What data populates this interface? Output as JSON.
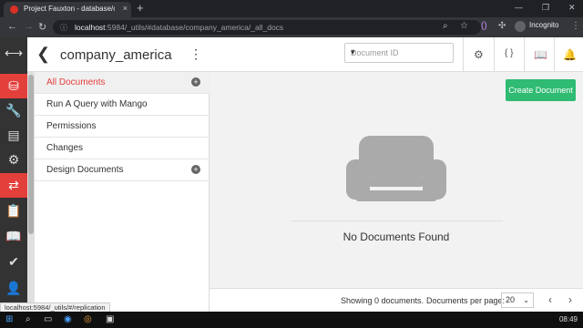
{
  "browser": {
    "tab_title": "Project Fauxton - database/comp",
    "url_host": "localhost",
    "url_rest": ":5984/_utils/#database/company_america/_all_docs",
    "incognito_label": "Incognito",
    "new_tab": "+",
    "tab_close": "×"
  },
  "header": {
    "db_name": "company_america",
    "doc_id_placeholder": "Document ID"
  },
  "sidenav": {
    "items": [
      {
        "label": "All Documents"
      },
      {
        "label": "Run A Query with Mango"
      },
      {
        "label": "Permissions"
      },
      {
        "label": "Changes"
      },
      {
        "label": "Design Documents"
      }
    ]
  },
  "main": {
    "create_label": "Create Document",
    "empty_label": "No Documents Found"
  },
  "footer": {
    "showing": "Showing 0 documents.",
    "per_page_label": "Documents per page:",
    "per_page_value": "20"
  },
  "status_url": "localhost:5984/_utils/#/replication",
  "taskbar": {
    "time": "08:49"
  },
  "colors": {
    "accent": "#e33f3b",
    "create": "#2fbb72"
  }
}
